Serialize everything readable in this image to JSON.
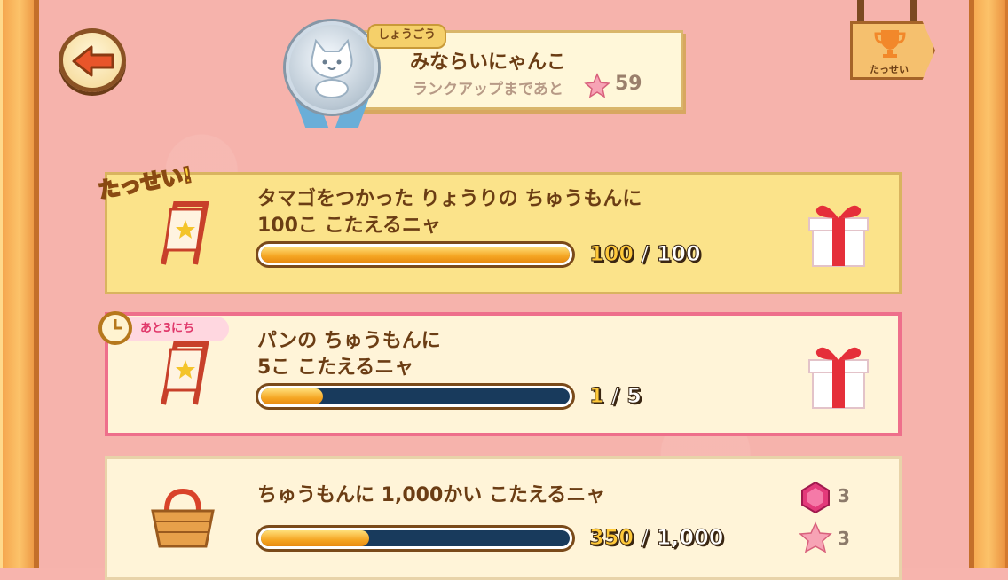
{
  "header": {
    "tag": "しょうごう",
    "title_name": "みならいにゃんこ",
    "rank_text": "ランクアップまであと",
    "rank_count": "59",
    "achievements_label": "たっせい"
  },
  "missions": [
    {
      "line1": "タマゴをつかった りょうりの ちゅうもんに",
      "line2": "100こ こたえるニャ",
      "current": "100",
      "sep": " / ",
      "total": "100",
      "progress": 1.0,
      "stamp": "たっせい!"
    },
    {
      "line1": "パンの ちゅうもんに",
      "line2": "5こ こたえるニャ",
      "current": "1",
      "sep": " / ",
      "total": "5",
      "progress": 0.2,
      "days_left": "あと3にち"
    },
    {
      "line1": "ちゅうもんに 1,000かい こたえるニャ",
      "current": "350",
      "sep": " / ",
      "total": "1,000",
      "progress": 0.35,
      "rewards": [
        {
          "icon": "gem-icon",
          "count": "3"
        },
        {
          "icon": "star-icon",
          "count": "3"
        }
      ]
    }
  ],
  "colors": {
    "background": "#f6b3ac",
    "frame": "#f4a24a",
    "completed_card": "#fbe38a",
    "active_border": "#ee6f8b"
  }
}
